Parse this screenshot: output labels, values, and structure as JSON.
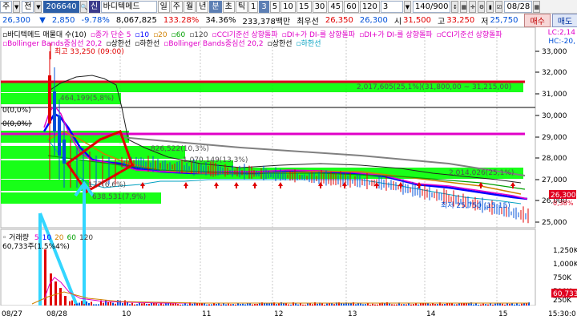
{
  "toolbar": {
    "type_sel": "주",
    "jeon_sel": "전",
    "code": "206640",
    "shin": "신",
    "name": "바디텍메드",
    "periods": [
      "일",
      "주",
      "월",
      "년"
    ],
    "minute": "분",
    "tick": "초",
    "tick2": "틱",
    "intervals": [
      "1",
      "3",
      "5",
      "10",
      "15",
      "30",
      "45",
      "60",
      "120"
    ],
    "sub_value": "3",
    "count": "140",
    "count_total": "900",
    "date": "08/28"
  },
  "quote": {
    "price": "26,300",
    "change": "2,850",
    "rate": "-9.78%",
    "volume": "8,067,825",
    "vol_rate": "133.28%",
    "turnover": "34.36%",
    "amount": "233,378백만",
    "best_label": "최우선",
    "best_ask": "26,350",
    "best_bid": "26,300",
    "open_label": "시",
    "open": "31,500",
    "high_label": "고",
    "high": "33,250",
    "low_label": "저",
    "low": "25,750",
    "buy": "매수",
    "sell": "매도"
  },
  "legend": {
    "line1": [
      {
        "text": "바디텍메드 매물대 수(10)",
        "color": "#000000"
      },
      {
        "text": "종가 단순 5",
        "color": "#e000c8"
      },
      {
        "text": "10",
        "color": "#0000ff"
      },
      {
        "text": "20",
        "color": "#d08000"
      },
      {
        "text": "60",
        "color": "#00a000"
      },
      {
        "text": "120",
        "color": "#404040"
      },
      {
        "text": "CCI기준선 상향돌파",
        "color": "#e000c8"
      },
      {
        "text": "DI+가 DI-를 상향돌파",
        "color": "#e000c8"
      },
      {
        "text": "DI+가 DI-를 상향돌파",
        "color": "#e000c8"
      },
      {
        "text": "CCI기준선 상향돌파",
        "color": "#e000c8"
      }
    ],
    "line2": [
      {
        "text": "Bollinger Bands중심선 20,2",
        "color": "#e000c8"
      },
      {
        "text": "상한선",
        "color": "#000000"
      },
      {
        "text": "하한선",
        "color": "#000000"
      },
      {
        "text": "Bollinger Bands중심선 20,2",
        "color": "#e000c8"
      },
      {
        "text": "상한선",
        "color": "#000000"
      },
      {
        "text": "하한선",
        "color": "#00a0c0"
      }
    ],
    "right_top": "LC:2,14",
    "right_top2": "HC:-20,"
  },
  "annotations": {
    "high_mark": "최고 33,250 (09:00)",
    "low_mark": "최저 25,750 (15:15)",
    "zero1": "0(0,0%)",
    "zero2": "0(0,0%)",
    "vp1": "2,017,605(25,1%)(31,800,00 ~ 31,215,00)",
    "vp2": "464,199(5,8%)",
    "vp3": "826,522(10,3%)",
    "vp4": "1,070,149(13,3%)",
    "vp5": "2,014,026(25,1%)",
    "vp6": "177(6,6%)",
    "vp7": "638,531(7,9%)",
    "price_tag": "26,300",
    "price_tag_pct": "0,38%",
    "vol_tag": "60,733"
  },
  "price_axis": [
    "33,000",
    "32,000",
    "31,000",
    "30,000",
    "29,000",
    "28,000",
    "27,000",
    "26,000",
    "25,000"
  ],
  "volume_panel": {
    "title": "거래량",
    "ma_labels": [
      "5",
      "10",
      "20",
      "60",
      "120"
    ],
    "ma_colors": [
      "#e000c8",
      "#0000ff",
      "#d08000",
      "#00a000",
      "#404040"
    ],
    "value_text": "60,733주(1.5%4%)",
    "axis": [
      "1,250K",
      "1,000K",
      "750K",
      "500K",
      "250K",
      "0K"
    ]
  },
  "time_axis": [
    "08/27",
    "08/28",
    "10",
    "11",
    "12",
    "13",
    "14",
    "15",
    "15:30:0"
  ],
  "colors": {
    "up": "#e00000",
    "down": "#0050d8",
    "volume_profile": "#00ff00",
    "current_line": "#e00020",
    "magenta_line": "#e000c8",
    "arrow": "#33d6ff"
  }
}
